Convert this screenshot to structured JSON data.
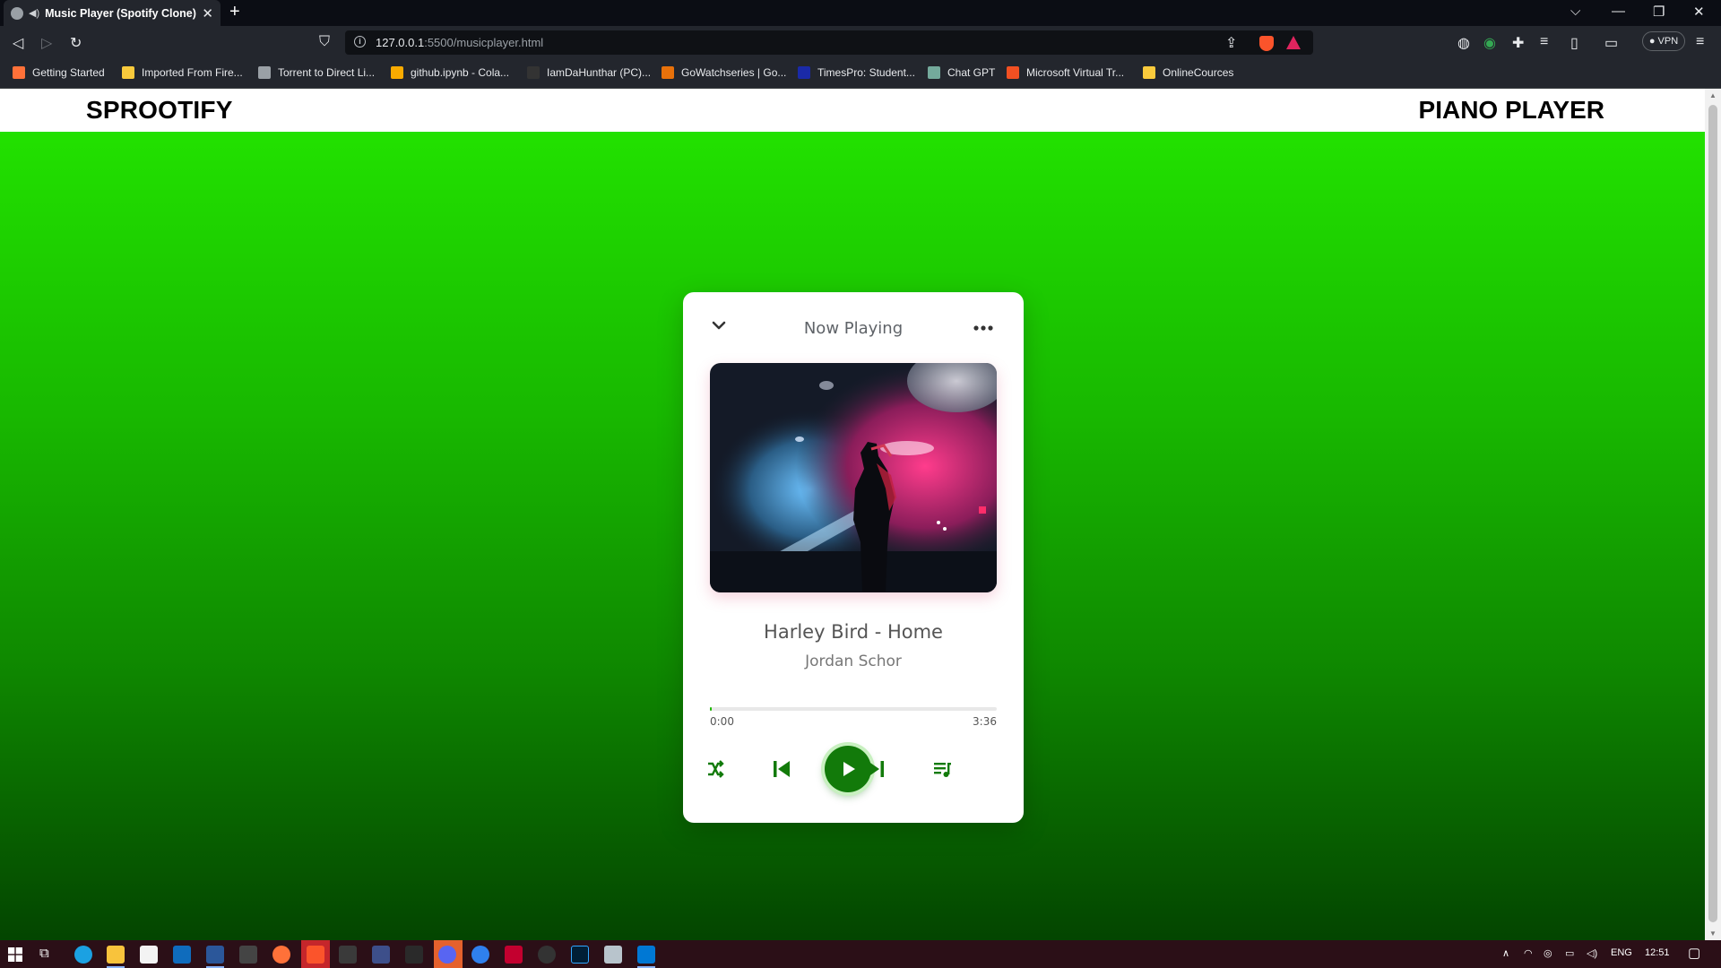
{
  "browser": {
    "tab_title": "Music Player (Spotify Clone)",
    "url_host": "127.0.0.1",
    "url_path": ":5500/musicplayer.html",
    "vpn_label": "VPN",
    "bookmarks": [
      {
        "label": "Getting Started",
        "color": "#ff7139"
      },
      {
        "label": "Imported From Fire...",
        "color": "#f9ca3c"
      },
      {
        "label": "Torrent to Direct Li...",
        "color": "#9aa0a6"
      },
      {
        "label": "github.ipynb - Cola...",
        "color": "#f9ab00"
      },
      {
        "label": "IamDaHunthar (PC)...",
        "color": "#333333"
      },
      {
        "label": "GoWatchseries | Go...",
        "color": "#e8710a"
      },
      {
        "label": "TimesPro: Student...",
        "color": "#1a2aa8"
      },
      {
        "label": "Chat GPT",
        "color": "#74aa9c"
      },
      {
        "label": "Microsoft Virtual Tr...",
        "color": "#f25022"
      },
      {
        "label": "OnlineCources",
        "color": "#f9ca3c"
      }
    ]
  },
  "site": {
    "logo": "SPROOTIFY",
    "nav_right": "PIANO PLAYER"
  },
  "player": {
    "header": "Now Playing",
    "song_title": "Harley Bird - Home",
    "artist": "Jordan Schor",
    "current_time": "0:00",
    "total_time": "3:36",
    "progress_fraction": 0.004,
    "accent_color": "#127a0a"
  },
  "taskbar": {
    "language": "ENG",
    "clock": "12:51"
  }
}
